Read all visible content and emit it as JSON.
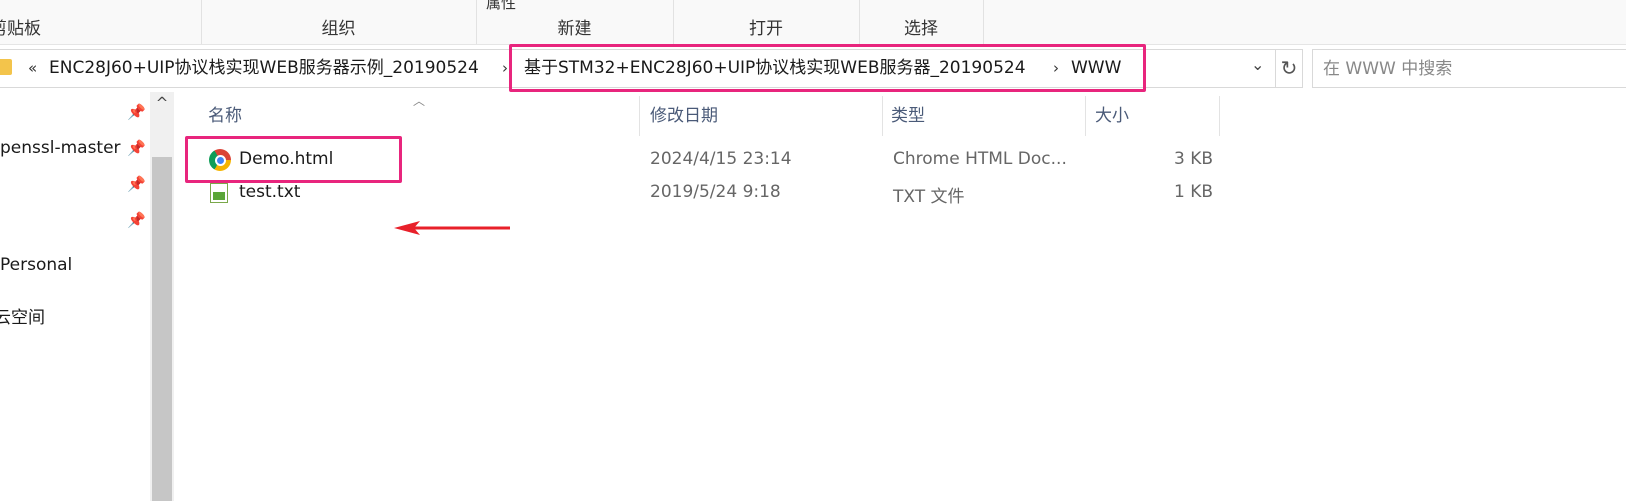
{
  "ribbon": {
    "groups": [
      "剪贴板",
      "组织",
      "新建",
      "打开",
      "选择"
    ],
    "cut_text": "属性"
  },
  "address": {
    "overflow": "«",
    "crumbs": [
      "ENC28J60+UIP协议栈实现WEB服务器示例_20190524",
      "基于STM32+ENC28J60+UIP协议栈实现WEB服务器_20190524",
      "WWW"
    ],
    "sep": "›",
    "dropdown": "⌄",
    "refresh": "↻"
  },
  "search": {
    "placeholder": "在 WWW 中搜索"
  },
  "nav": {
    "items": [
      "penssl-master",
      "Personal",
      "云空间"
    ],
    "pin": "📌",
    "scroll_up": "^"
  },
  "columns": {
    "name": "名称",
    "modified": "修改日期",
    "type": "类型",
    "size": "大小"
  },
  "files": [
    {
      "name": "Demo.html",
      "modified": "2024/4/15 23:14",
      "type": "Chrome HTML Doc...",
      "size": "3 KB"
    },
    {
      "name": "test.txt",
      "modified": "2019/5/24 9:18",
      "type": "TXT 文件",
      "size": "1 KB"
    }
  ],
  "colors": {
    "highlight": "#e8257d",
    "arrow": "#e8202a"
  }
}
